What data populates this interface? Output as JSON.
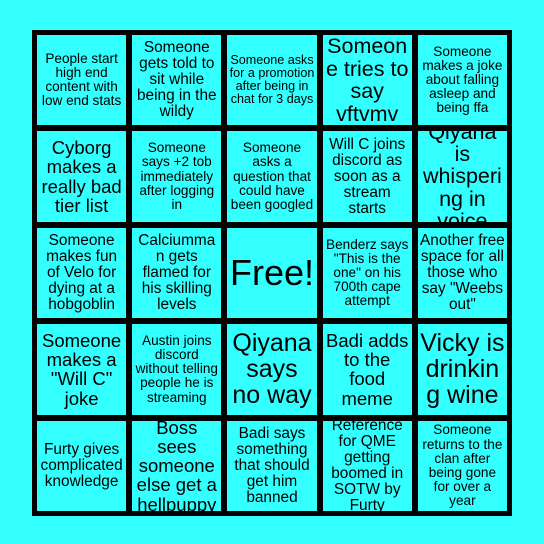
{
  "card": {
    "name": "bingo-card",
    "background_color": "#33ffff",
    "grid_color": "#000000",
    "cell_color": "#33ffff",
    "text_color": "#000000",
    "columns": 5,
    "rows": 5,
    "free_space_label": "Free!",
    "cells": [
      {
        "text": "People start high end content with low end stats",
        "size": "sz-s",
        "free": false
      },
      {
        "text": "Someone gets told to sit while being in the wildy",
        "size": "sz-m",
        "free": false
      },
      {
        "text": "Someone asks for a promotion after being in chat for 3 days",
        "size": "sz-xs",
        "free": false
      },
      {
        "text": "Someone tries to say vftvmv",
        "size": "sz-xl",
        "free": false
      },
      {
        "text": "Someone makes a joke about falling asleep and being ffa",
        "size": "sz-s",
        "free": false
      },
      {
        "text": "Cyborg makes a really bad tier list",
        "size": "sz-l",
        "free": false
      },
      {
        "text": "Someone says +2 tob immediately after logging in",
        "size": "sz-s",
        "free": false
      },
      {
        "text": "Someone asks a question that could have been googled",
        "size": "sz-s",
        "free": false
      },
      {
        "text": "Will C joins discord as soon as a stream starts",
        "size": "sz-m",
        "free": false
      },
      {
        "text": "Qiyana is whispering in voice",
        "size": "sz-xl",
        "free": false
      },
      {
        "text": "Someone makes fun of Velo for dying at a hobgoblin",
        "size": "sz-m",
        "free": false
      },
      {
        "text": "Calciumman gets flamed for his skilling levels",
        "size": "sz-m",
        "free": false
      },
      {
        "text": "Free!",
        "size": "sz-free",
        "free": true
      },
      {
        "text": "Benderz says \"This is the one\" on his 700th cape attempt",
        "size": "sz-s",
        "free": false
      },
      {
        "text": "Another free space for all those who say \"Weebs out\"",
        "size": "sz-m",
        "free": false
      },
      {
        "text": "Someone makes a \"Will C\" joke",
        "size": "sz-l",
        "free": false
      },
      {
        "text": "Austin joins discord without telling people he is streaming",
        "size": "sz-s",
        "free": false
      },
      {
        "text": "Qiyana says no way",
        "size": "sz-xxl",
        "free": false
      },
      {
        "text": "Badi adds to the food meme",
        "size": "sz-l",
        "free": false
      },
      {
        "text": "Vicky is drinking wine",
        "size": "sz-xxl",
        "free": false
      },
      {
        "text": "Furty gives complicated knowledge",
        "size": "sz-m",
        "free": false
      },
      {
        "text": "Boss sees someone else get a hellpuppy",
        "size": "sz-l",
        "free": false
      },
      {
        "text": "Badi says something that should get him banned",
        "size": "sz-m",
        "free": false
      },
      {
        "text": "Reference for QME getting boomed in SOTW by Furty",
        "size": "sz-m",
        "free": false
      },
      {
        "text": "Someone returns to the clan after being gone for over a year",
        "size": "sz-s",
        "free": false
      }
    ]
  }
}
